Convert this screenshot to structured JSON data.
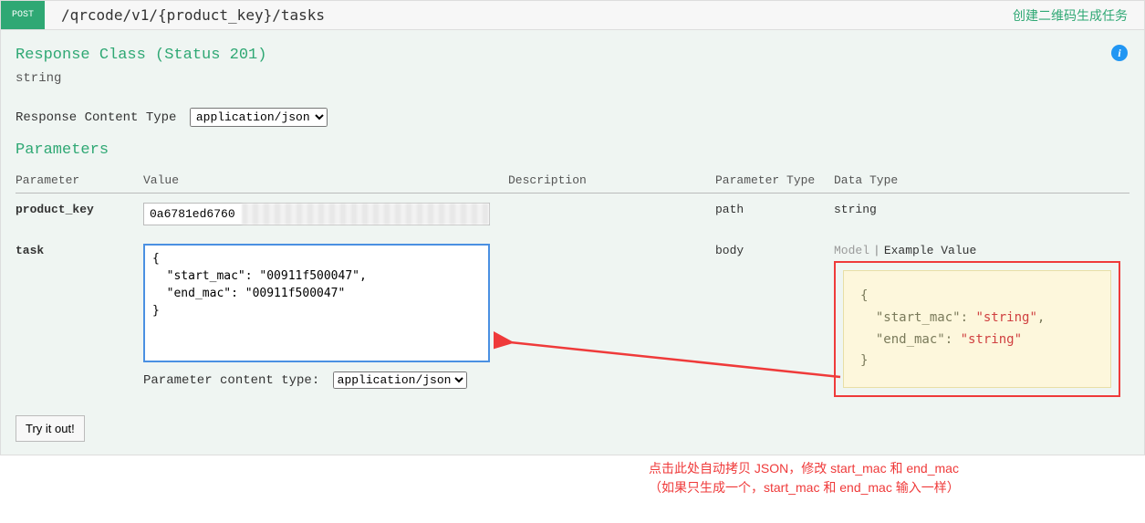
{
  "header": {
    "method": "POST",
    "path_prefix": "/qrcode/v1/",
    "path_param": "{product_key}",
    "path_suffix": "/tasks",
    "summary": "创建二维码生成任务"
  },
  "response": {
    "title": "Response Class (Status 201)",
    "type": "string",
    "content_type_label": "Response Content Type",
    "content_type_value": "application/json"
  },
  "parameters": {
    "title": "Parameters",
    "columns": {
      "parameter": "Parameter",
      "value": "Value",
      "description": "Description",
      "param_type": "Parameter Type",
      "data_type": "Data Type"
    },
    "rows": [
      {
        "name": "product_key",
        "value": "0a6781ed6760",
        "description": "",
        "param_type": "path",
        "data_type": "string"
      },
      {
        "name": "task",
        "value": "{\n  \"start_mac\": \"00911f500047\",\n  \"end_mac\": \"00911f500047\"\n}",
        "description": "",
        "param_type": "body",
        "data_type_tabs": {
          "model": "Model",
          "example": "Example Value"
        },
        "example_json": "{\n  \"start_mac\": \"string\",\n  \"end_mac\": \"string\"\n}"
      }
    ],
    "content_type_label": "Parameter content type:",
    "content_type_value": "application/json"
  },
  "actions": {
    "try": "Try it out!"
  },
  "annotation": {
    "line1": "点击此处自动拷贝 JSON，修改 start_mac 和 end_mac",
    "line2": "（如果只生成一个，start_mac 和 end_mac 输入一样）"
  },
  "info_icon_glyph": "i"
}
